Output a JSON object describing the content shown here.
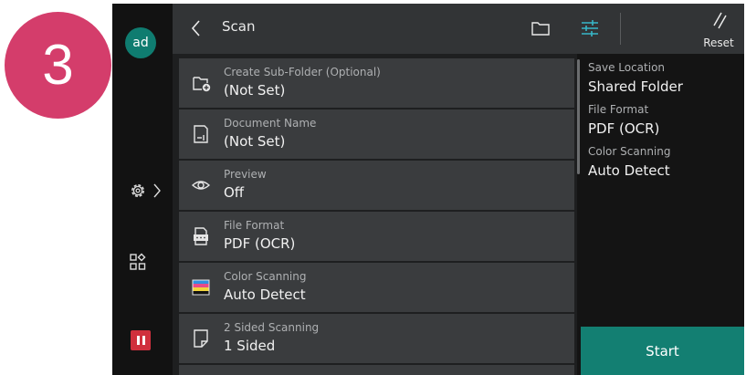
{
  "step_badge": "3",
  "nav": {
    "avatar_initials": "ad"
  },
  "header": {
    "title": "Scan",
    "reset_label": "Reset"
  },
  "list": [
    {
      "label": "Create Sub-Folder (Optional)",
      "value": "(Not Set)",
      "icon": "folder-plus-icon"
    },
    {
      "label": "Document Name",
      "value": "(Not Set)",
      "icon": "document-name-icon"
    },
    {
      "label": "Preview",
      "value": "Off",
      "icon": "eye-icon"
    },
    {
      "label": "File Format",
      "value": "PDF (OCR)",
      "icon": "file-format-icon"
    },
    {
      "label": "Color Scanning",
      "value": "Auto Detect",
      "icon": "color-scanning-icon"
    },
    {
      "label": "2 Sided Scanning",
      "value": "1 Sided",
      "icon": "page-sides-icon"
    }
  ],
  "summary": {
    "save_location_label": "Save Location",
    "save_location_value": "Shared Folder",
    "file_format_label": "File Format",
    "file_format_value": "PDF (OCR)",
    "color_scanning_label": "Color Scanning",
    "color_scanning_value": "Auto Detect",
    "start_label": "Start"
  },
  "colors": {
    "accent": "#137f72",
    "badge": "#d43d6b",
    "stop": "#d0303d",
    "settings_icon": "#37b6c8"
  }
}
